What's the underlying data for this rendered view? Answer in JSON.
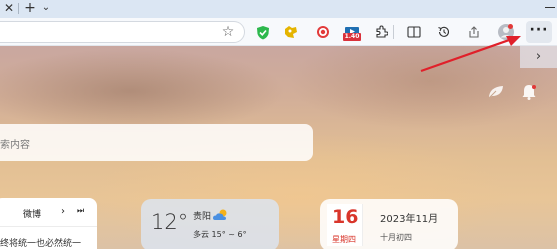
{
  "titlebar": {
    "tab_close_glyph": "✕",
    "new_tab_glyph": "+",
    "tab_menu_glyph": "⌄"
  },
  "toolbar": {
    "star_glyph": "☆",
    "video_badge": "1.40",
    "more_glyph": "···",
    "icons": [
      "star-icon",
      "shield-icon",
      "puzzle-ext-icon",
      "target-icon",
      "video-icon",
      "extensions-icon",
      "split-screen-icon",
      "history-icon",
      "share-icon",
      "profile-icon",
      "more-icon"
    ],
    "accent_color": "#d9323c"
  },
  "sidepanel": {
    "chevron_glyph": "›"
  },
  "search": {
    "placeholder": "索内容"
  },
  "news": {
    "title": "微博",
    "next_glyph": "›",
    "end_glyph": "⏭",
    "line": "终将统一也必然统一"
  },
  "weather": {
    "temperature": "12°",
    "city": "贵阳",
    "forecast": "多云 15° ~ 6°"
  },
  "calendar": {
    "day": "16",
    "weekday": "星期四",
    "date": "2023年11月",
    "lunar": "十月初四",
    "accent_color": "#d9362b"
  }
}
